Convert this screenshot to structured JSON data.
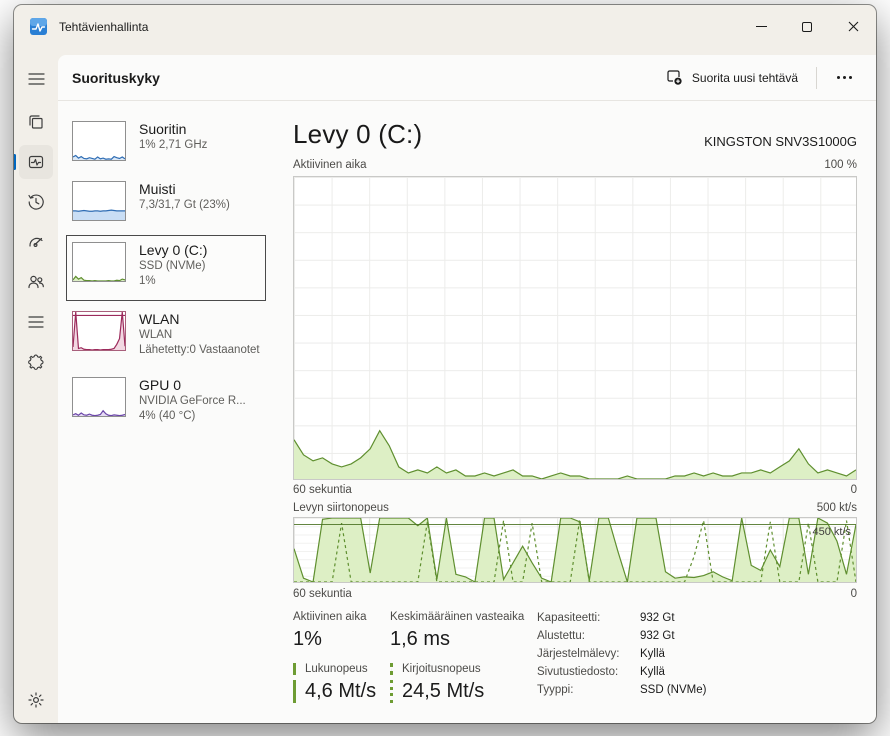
{
  "titlebar": {
    "app_title": "Tehtävienhallinta"
  },
  "icons": {
    "app": "task-manager-logo",
    "window": [
      "minimize-icon",
      "maximize-icon",
      "close-icon"
    ],
    "sidebar": [
      "hamburger-icon",
      "processes-icon",
      "performance-icon",
      "app-history-icon",
      "startup-apps-icon",
      "users-icon",
      "details-icon",
      "services-icon",
      "settings-icon"
    ],
    "header": [
      "new-task-icon",
      "more-icon"
    ]
  },
  "header": {
    "title": "Suorituskyky",
    "run_task_label": "Suorita uusi tehtävä"
  },
  "colors": {
    "accent_blue": "#0067c0",
    "disk_green_stroke": "#5f8f2f",
    "disk_green_fill": "#ddefc5",
    "cpu_blue": "#2f6db4",
    "wlan_maroon": "#9c2b5c",
    "gpu_purple": "#6b46a8"
  },
  "devices": [
    {
      "name": "Suoritin",
      "sub1": "1% 2,71 GHz",
      "stroke": "#2f6db4",
      "fill": "#dce9f7",
      "values": [
        8,
        12,
        5,
        9,
        4,
        3,
        6,
        4,
        2,
        8,
        3,
        5,
        2,
        3,
        2,
        9,
        6,
        4,
        8,
        3
      ]
    },
    {
      "name": "Muisti",
      "sub1": "7,3/31,7 Gt (23%)",
      "stroke": "#2f6db4",
      "fill": "#c9def5",
      "values": [
        24,
        24,
        23,
        24,
        25,
        24,
        23,
        23,
        24,
        24,
        23,
        24,
        24,
        25,
        26,
        25,
        24,
        24,
        24,
        24
      ]
    },
    {
      "name": "Levy 0 (C:)",
      "sub1": "SSD (NVMe)",
      "sub2": "1%",
      "selected": true,
      "stroke": "#5f8f2f",
      "fill": "#ddefc5",
      "values": [
        3,
        12,
        5,
        9,
        2,
        1,
        1,
        0,
        1,
        0,
        0,
        0,
        0,
        1,
        0,
        0,
        2,
        1,
        5,
        3
      ]
    },
    {
      "name": "WLAN",
      "sub1": "WLAN",
      "sub2": "Lähetetty:0 Vastaanotet",
      "stroke": "#9c2b5c",
      "fill": "#f2d8e2",
      "topline": true,
      "values": [
        8,
        100,
        4,
        6,
        2,
        1,
        1,
        0,
        1,
        1,
        0,
        1,
        1,
        1,
        2,
        4,
        15,
        30,
        100,
        10
      ]
    },
    {
      "name": "GPU 0",
      "sub1": "NVIDIA GeForce R...",
      "sub2": "4% (40 °C)",
      "stroke": "#6b46a8",
      "fill": "#e5dbf4",
      "values": [
        3,
        6,
        2,
        8,
        3,
        2,
        5,
        2,
        1,
        2,
        4,
        14,
        6,
        2,
        1,
        3,
        2,
        1,
        2,
        4
      ]
    }
  ],
  "main": {
    "title": "Levy 0 (C:)",
    "device_name": "KINGSTON SNV3S1000G",
    "chart_active": {
      "label": "Aktiivinen aika",
      "scale_max": "100 %",
      "x_left": "60 sekuntia",
      "x_right": "0"
    },
    "chart_transfer": {
      "label": "Levyn siirtonopeus",
      "scale_max": "500 kt/s",
      "marker_label": "450 kt/s",
      "x_left": "60 sekuntia",
      "x_right": "0"
    },
    "stats": {
      "active_time_label": "Aktiivinen aika",
      "active_time_value": "1%",
      "avg_response_label": "Keskimääräinen vasteaika",
      "avg_response_value": "1,6 ms",
      "read_speed_label": "Lukunopeus",
      "read_speed_value": "4,6 Mt/s",
      "write_speed_label": "Kirjoitusnopeus",
      "write_speed_value": "24,5 Mt/s"
    },
    "details": [
      {
        "label": "Kapasiteetti:",
        "value": "932 Gt"
      },
      {
        "label": "Alustettu:",
        "value": "932 Gt"
      },
      {
        "label": "Järjestelmälevy:",
        "value": "Kyllä"
      },
      {
        "label": "Sivutustiedosto:",
        "value": "Kyllä"
      },
      {
        "label": "Tyyppi:",
        "value": "SSD (NVMe)"
      }
    ]
  },
  "chart_data": [
    {
      "type": "area",
      "title": "Aktiivinen aika",
      "ylabel": "% active time",
      "ylim": [
        0,
        100
      ],
      "x_span_label": "60 sekuntia",
      "x_end_label": "0",
      "grid": true,
      "unit": "%",
      "values": [
        13,
        8,
        6,
        7,
        5,
        4,
        5,
        7,
        10,
        16,
        11,
        4,
        2,
        3,
        2,
        4,
        2,
        3,
        1,
        1,
        2,
        1,
        2,
        3,
        1,
        1,
        0,
        1,
        2,
        1,
        1,
        0,
        0,
        0,
        0,
        1,
        0,
        0,
        0,
        0,
        1,
        1,
        2,
        1,
        2,
        1,
        1,
        2,
        2,
        3,
        2,
        4,
        6,
        10,
        5,
        2,
        3,
        2,
        1,
        3
      ]
    },
    {
      "type": "area",
      "title": "Levyn siirtonopeus",
      "ylabel": "kt/s",
      "ylim": [
        0,
        500
      ],
      "marker": 450,
      "x_span_label": "60 sekuntia",
      "x_end_label": "0",
      "grid": true,
      "unit": "kt/s",
      "values": [
        260,
        30,
        0,
        490,
        500,
        500,
        500,
        500,
        70,
        500,
        500,
        500,
        500,
        440,
        500,
        20,
        500,
        60,
        40,
        0,
        500,
        500,
        20,
        150,
        280,
        150,
        30,
        0,
        500,
        500,
        470,
        10,
        500,
        500,
        240,
        0,
        500,
        500,
        500,
        80,
        30,
        40,
        35,
        50,
        80,
        40,
        10,
        500,
        130,
        90,
        250,
        120,
        500,
        500,
        60,
        500,
        460,
        320,
        60,
        450
      ],
      "read_values": [
        0,
        0,
        0,
        0,
        0,
        460,
        0,
        0,
        0,
        0,
        0,
        0,
        0,
        0,
        470,
        0,
        0,
        0,
        0,
        0,
        0,
        0,
        480,
        0,
        0,
        460,
        0,
        0,
        0,
        0,
        490,
        0,
        0,
        0,
        0,
        0,
        0,
        0,
        0,
        0,
        0,
        0,
        200,
        480,
        0,
        0,
        0,
        0,
        0,
        0,
        470,
        0,
        0,
        0,
        460,
        0,
        0,
        0,
        480,
        0
      ]
    }
  ]
}
